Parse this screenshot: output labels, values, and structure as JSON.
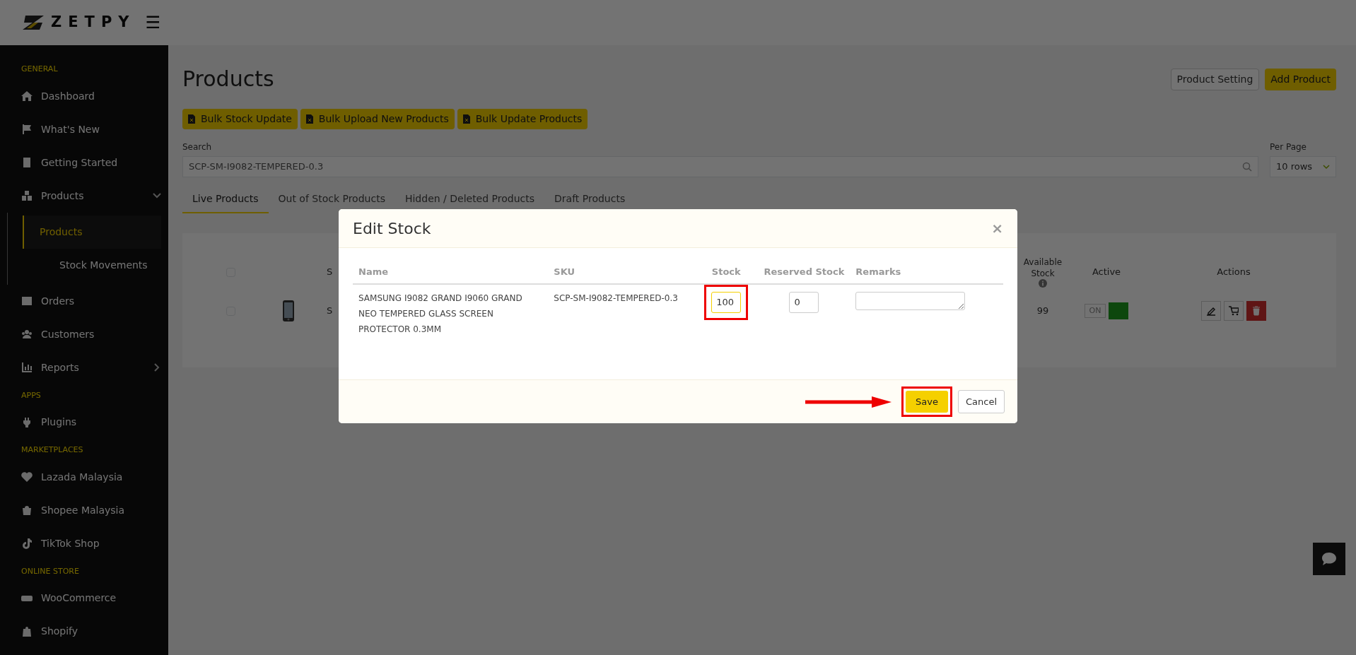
{
  "header": {
    "logo": "ZETPY",
    "menu_icon": "☰"
  },
  "sidebar": {
    "sections": [
      {
        "title": "GENERAL",
        "items": [
          {
            "label": "Dashboard",
            "selected": false
          },
          {
            "label": "What's New",
            "selected": false
          },
          {
            "label": "Getting Started",
            "selected": false
          },
          {
            "label": "Products",
            "selected": false,
            "expanded": true,
            "children": [
              {
                "label": "Products",
                "selected": true
              },
              {
                "label": "Stock Movements",
                "selected": false
              }
            ]
          },
          {
            "label": "Orders",
            "selected": false
          },
          {
            "label": "Customers",
            "selected": false
          },
          {
            "label": "Reports",
            "selected": false,
            "expanded": false
          }
        ]
      },
      {
        "title": "APPS",
        "items": [
          {
            "label": "Plugins",
            "selected": false
          }
        ]
      },
      {
        "title": "MARKETPLACES",
        "items": [
          {
            "label": "Lazada Malaysia",
            "selected": false
          },
          {
            "label": "Shopee Malaysia",
            "selected": false
          },
          {
            "label": "TikTok Shop",
            "selected": false
          }
        ]
      },
      {
        "title": "ONLINE STORE",
        "items": [
          {
            "label": "WooCommerce",
            "selected": false
          },
          {
            "label": "Shopify",
            "selected": false
          }
        ]
      }
    ]
  },
  "page": {
    "title": "Products",
    "header_buttons": [
      "Product Setting",
      "Add Product"
    ],
    "bulk_buttons": [
      "Bulk Stock Update",
      "Bulk Upload New Products",
      "Bulk Update Products"
    ],
    "search": {
      "label": "Search",
      "value": "SCP-SM-I9082-TEMPERED-0.3"
    },
    "per_page": {
      "label": "Per Page",
      "value": "10 rows"
    },
    "tabs": [
      {
        "label": "Live Products",
        "selected": true
      },
      {
        "label": "Out of Stock Products",
        "selected": false
      },
      {
        "label": "Hidden / Deleted Products",
        "selected": false
      },
      {
        "label": "Draft Products",
        "selected": false
      }
    ],
    "table": {
      "select_all_checked": false,
      "columns": [
        "S",
        "Available Stock",
        "Active",
        "Actions"
      ],
      "rows": [
        {
          "checked": false,
          "column_2": "S",
          "available_stock": "99",
          "active": {
            "label": "ON",
            "on": true
          }
        }
      ]
    }
  },
  "modal": {
    "title": "Edit Stock",
    "close": "×",
    "columns": [
      "Name",
      "SKU",
      "Stock",
      "Reserved Stock",
      "Remarks"
    ],
    "rows": [
      {
        "name": "SAMSUNG I9082 GRAND I9060 GRAND NEO TEMPERED GLASS SCREEN PROTECTOR 0.3MM",
        "sku": "SCP-SM-I9082-TEMPERED-0.3",
        "stock": "100",
        "reserved_stock": "0"
      }
    ],
    "buttons": [
      {
        "label": "Save",
        "kind": "primary"
      },
      {
        "label": "Cancel",
        "kind": "secondary"
      }
    ]
  }
}
